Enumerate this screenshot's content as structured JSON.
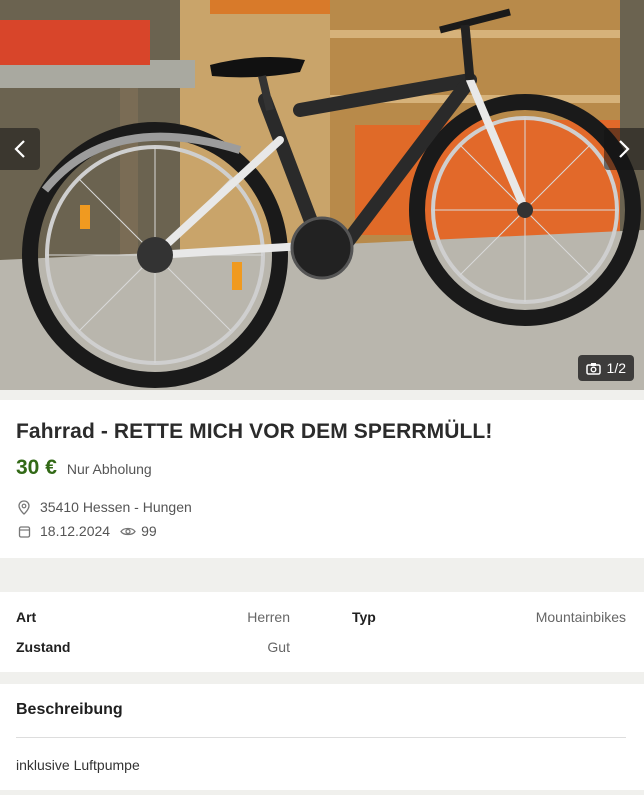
{
  "gallery": {
    "image_description_icon": "bicycle-photo",
    "counter": "1/2",
    "prev_icon": "chevron-left-icon",
    "next_icon": "chevron-right-icon",
    "camera_icon": "camera-icon"
  },
  "listing": {
    "title": "Fahrrad - RETTE MICH VOR DEM SPERRMÜLL!",
    "price": "30 €",
    "shipping": "Nur Abholung",
    "location": "35410 Hessen - Hungen",
    "date": "18.12.2024",
    "views": "99"
  },
  "attributes": {
    "art_label": "Art",
    "art_value": "Herren",
    "typ_label": "Typ",
    "typ_value": "Mountainbikes",
    "zustand_label": "Zustand",
    "zustand_value": "Gut"
  },
  "description": {
    "heading": "Beschreibung",
    "text": "inklusive Luftpumpe"
  },
  "colors": {
    "price_green": "#326916",
    "page_bg": "#f0f0ed"
  }
}
